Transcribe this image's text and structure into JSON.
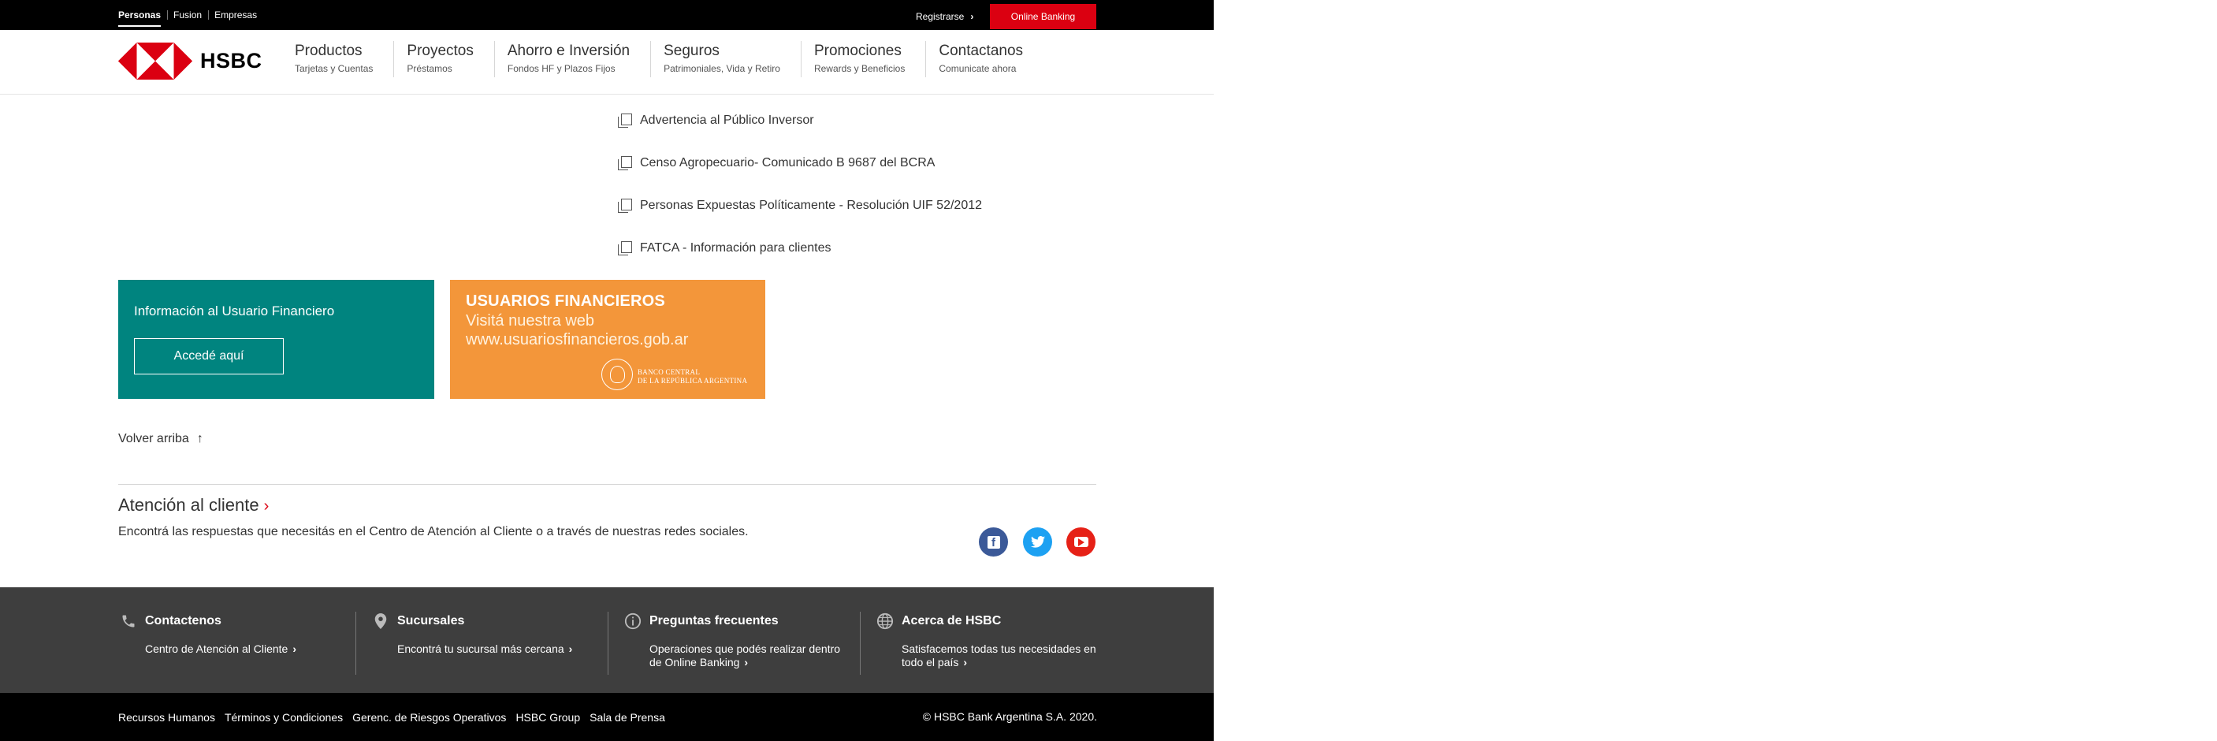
{
  "topbar": {
    "segments": [
      "Personas",
      "Fusion",
      "Empresas"
    ],
    "register": "Registrarse",
    "online_banking": "Online Banking"
  },
  "header": {
    "brand": "HSBC",
    "brand_colors": {
      "red": "#db0011",
      "black": "#000000"
    },
    "nav": [
      {
        "title": "Productos",
        "subtitle": "Tarjetas y Cuentas"
      },
      {
        "title": "Proyectos",
        "subtitle": "Préstamos"
      },
      {
        "title": "Ahorro e Inversión",
        "subtitle": "Fondos HF y Plazos Fijos"
      },
      {
        "title": "Seguros",
        "subtitle": "Patrimoniales, Vida y Retiro"
      },
      {
        "title": "Promociones",
        "subtitle": "Rewards y Beneficios"
      },
      {
        "title": "Contactanos",
        "subtitle": "Comunicate ahora"
      }
    ]
  },
  "main": {
    "doc_links": [
      "Advertencia al Público Inversor",
      "Censo Agropecuario- Comunicado B 9687 del BCRA",
      "Personas Expuestas Políticamente - Resolución UIF 52/2012",
      "FATCA - Información para clientes"
    ],
    "info_box": {
      "title": "Información al Usuario Financiero",
      "button": "Accedé aquí",
      "color": "#00847f"
    },
    "promo_box": {
      "heading": "USUARIOS FINANCIEROS",
      "line1": "Visitá nuestra web",
      "line2": "www.usuariosfinancieros.gob.ar",
      "seal_line1": "BANCO CENTRAL",
      "seal_line2": "DE LA REPÚBLICA ARGENTINA",
      "color": "#f3963a"
    },
    "back_to_top": "Volver arriba",
    "customer_service": {
      "title": "Atención al cliente",
      "text": "Encontrá las respuestas que necesitás en el Centro de Atención al Cliente o a través de nuestras redes sociales."
    },
    "social": [
      "facebook-icon",
      "twitter-icon",
      "youtube-icon"
    ]
  },
  "footer": {
    "columns": [
      {
        "icon": "phone-icon",
        "title": "Contactenos",
        "link": "Centro de Atención al Cliente"
      },
      {
        "icon": "location-pin-icon",
        "title": "Sucursales",
        "link": "Encontrá tu sucursal más cercana"
      },
      {
        "icon": "info-icon",
        "title": "Preguntas frecuentes",
        "link": "Operaciones que podés realizar dentro de Online Banking"
      },
      {
        "icon": "globe-icon",
        "title": "Acerca de HSBC",
        "link": "Satisfacemos todas tus necesidades en todo el país"
      }
    ],
    "bottom_links": [
      "Recursos Humanos",
      "Términos y Condiciones",
      "Gerenc. de Riesgos Operativos",
      "HSBC Group",
      "Sala de Prensa"
    ],
    "copyright": "© HSBC Bank Argentina S.A. 2020."
  }
}
